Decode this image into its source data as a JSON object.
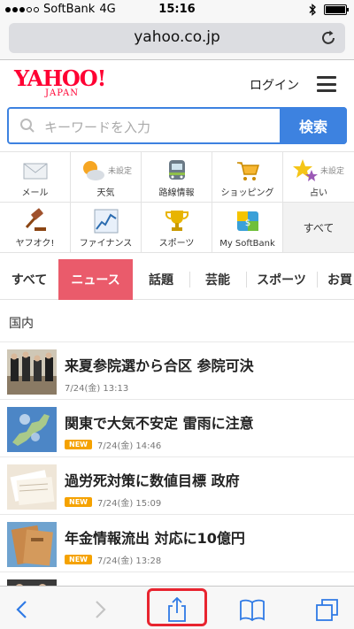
{
  "status_bar": {
    "carrier": "SoftBank",
    "network": "4G",
    "time": "15:16"
  },
  "browser": {
    "url": "yahoo.co.jp"
  },
  "header": {
    "logo_main": "YAHOO!",
    "logo_sub": "JAPAN",
    "login": "ログイン"
  },
  "search": {
    "placeholder": "キーワードを入力",
    "button": "検索"
  },
  "services": [
    {
      "label": "メール",
      "icon": "mail-icon"
    },
    {
      "label": "天気",
      "icon": "weather-icon",
      "note": "未設定"
    },
    {
      "label": "路線情報",
      "icon": "train-icon"
    },
    {
      "label": "ショッピング",
      "icon": "cart-icon"
    },
    {
      "label": "占い",
      "icon": "star-icon",
      "note": "未設定"
    },
    {
      "label": "ヤフオク!",
      "icon": "gavel-icon"
    },
    {
      "label": "ファイナンス",
      "icon": "chart-icon"
    },
    {
      "label": "スポーツ",
      "icon": "trophy-icon"
    },
    {
      "label": "My SoftBank",
      "icon": "softbank-icon"
    },
    {
      "label": "すべて",
      "icon": ""
    }
  ],
  "tabs": [
    "すべて",
    "ニュース",
    "話題",
    "芸能",
    "スポーツ",
    "お買"
  ],
  "section": {
    "title": "国内"
  },
  "news": [
    {
      "headline": "来夏参院選から合区 参院可決",
      "date": "7/24(金) 13:13",
      "new": ""
    },
    {
      "headline": "関東で大気不安定 雷雨に注意",
      "date": "7/24(金) 14:46",
      "new": "NEW"
    },
    {
      "headline": "過労死対策に数値目標 政府",
      "date": "7/24(金) 15:09",
      "new": "NEW"
    },
    {
      "headline": "年金情報流出 対応に10億円",
      "date": "7/24(金) 13:28",
      "new": "NEW"
    }
  ],
  "colors": {
    "accent": "#3d82e0",
    "brand": "#ff0033",
    "tab_active": "#ea5b6b",
    "new_badge": "#f5a200",
    "highlight": "#e8242f"
  }
}
